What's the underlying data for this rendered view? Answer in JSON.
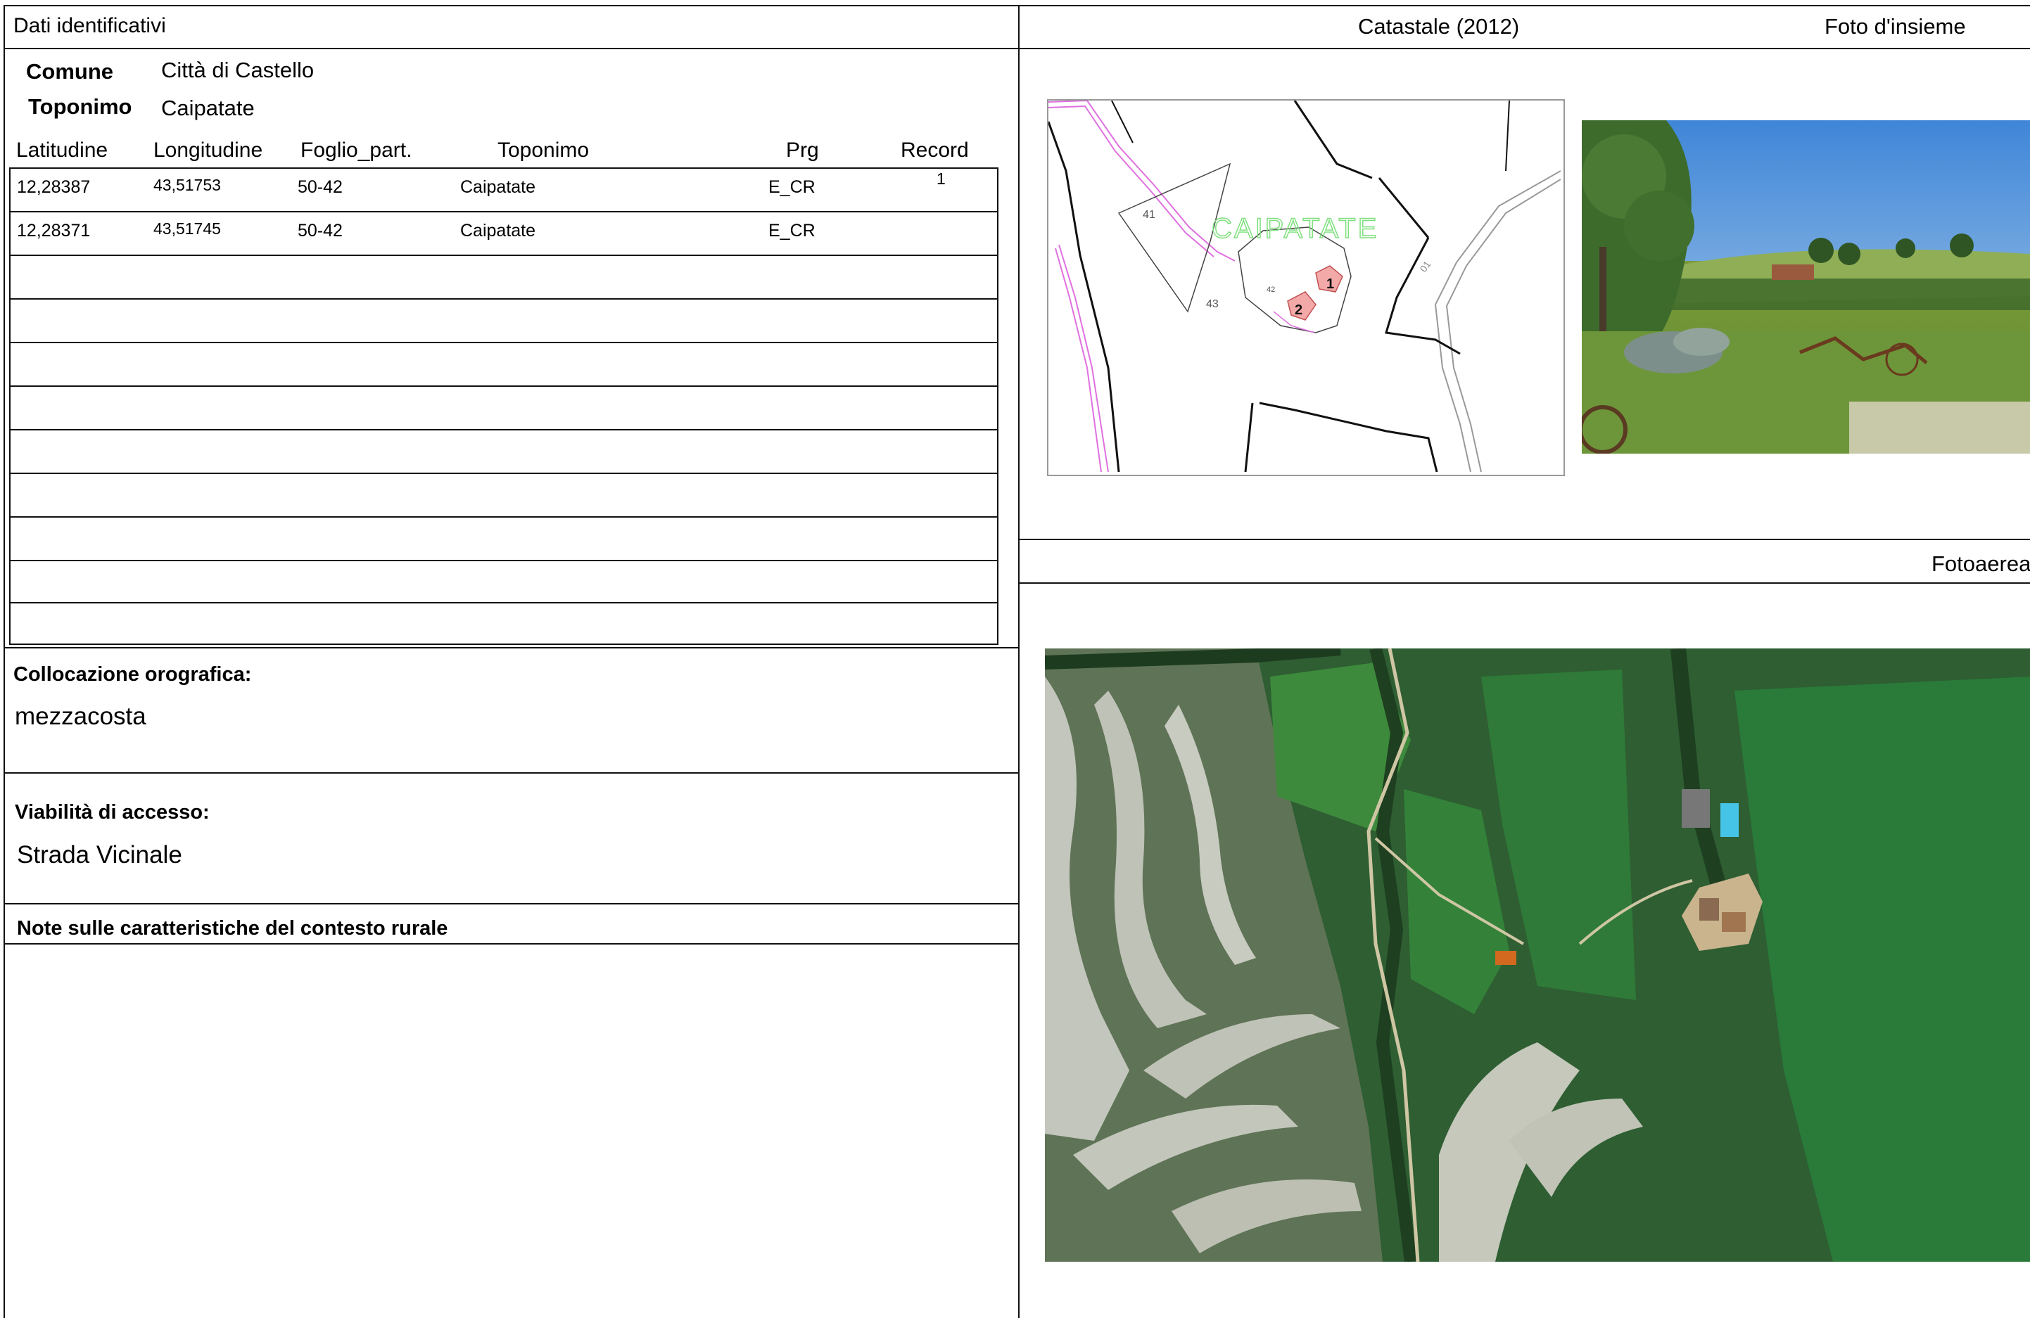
{
  "left": {
    "header": "Dati identificativi",
    "comune_label": "Comune",
    "comune_value": "Città di Castello",
    "toponimo_label": "Toponimo",
    "toponimo_value": "Caipatate",
    "table": {
      "headers": [
        "Latitudine",
        "Longitudine",
        "Foglio_part.",
        "Toponimo",
        "Prg",
        "Record"
      ],
      "rows": [
        [
          "12,28387",
          "43,51753",
          "50-42",
          "Caipatate",
          "E_CR",
          "1"
        ],
        [
          "12,28371",
          "43,51745",
          "50-42",
          "Caipatate",
          "E_CR",
          ""
        ]
      ]
    },
    "collocazione_label": "Collocazione orografica:",
    "collocazione_value": "mezzacosta",
    "viabilita_label": "Viabilità di accesso:",
    "viabilita_value": "Strada Vicinale",
    "note_label": "Note sulle caratteristiche del contesto rurale"
  },
  "right": {
    "catastale_header": "Catastale (2012)",
    "foto_header": "Foto d'insieme",
    "fotoaerea_header": "Fotoaerea",
    "map": {
      "place_label": "CAIPATATE",
      "parcel_41": "41",
      "parcel_42": "42",
      "parcel_43": "43",
      "building_1": "1",
      "building_2": "2",
      "road_label": "01"
    }
  }
}
